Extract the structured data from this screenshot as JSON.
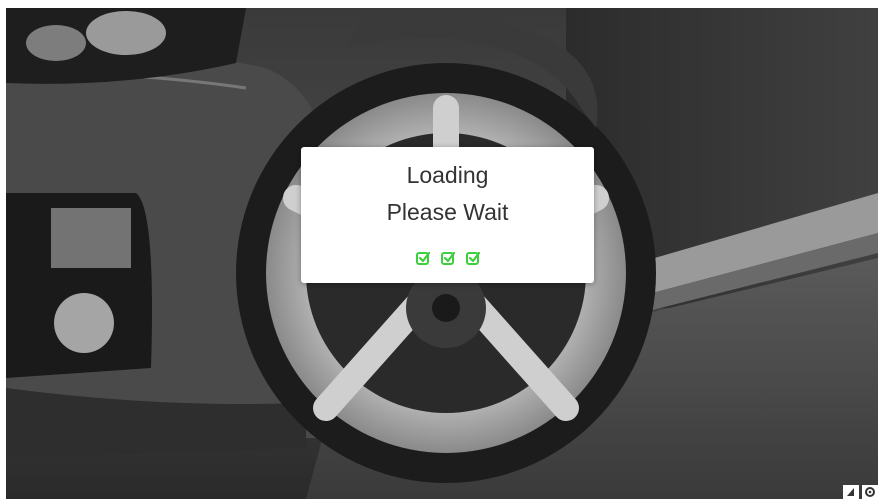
{
  "background": {
    "scene": "car-wheel-photo",
    "tone": "grayscale"
  },
  "loading_dialog": {
    "title": "Loading",
    "subtitle": "Please Wait",
    "indicator_icons": [
      "check-square-icon",
      "check-square-icon",
      "check-square-icon"
    ],
    "indicator_color": "#3ecf3e"
  },
  "corner_controls": {
    "icons": [
      "triangle-icon",
      "gear-icon"
    ]
  }
}
